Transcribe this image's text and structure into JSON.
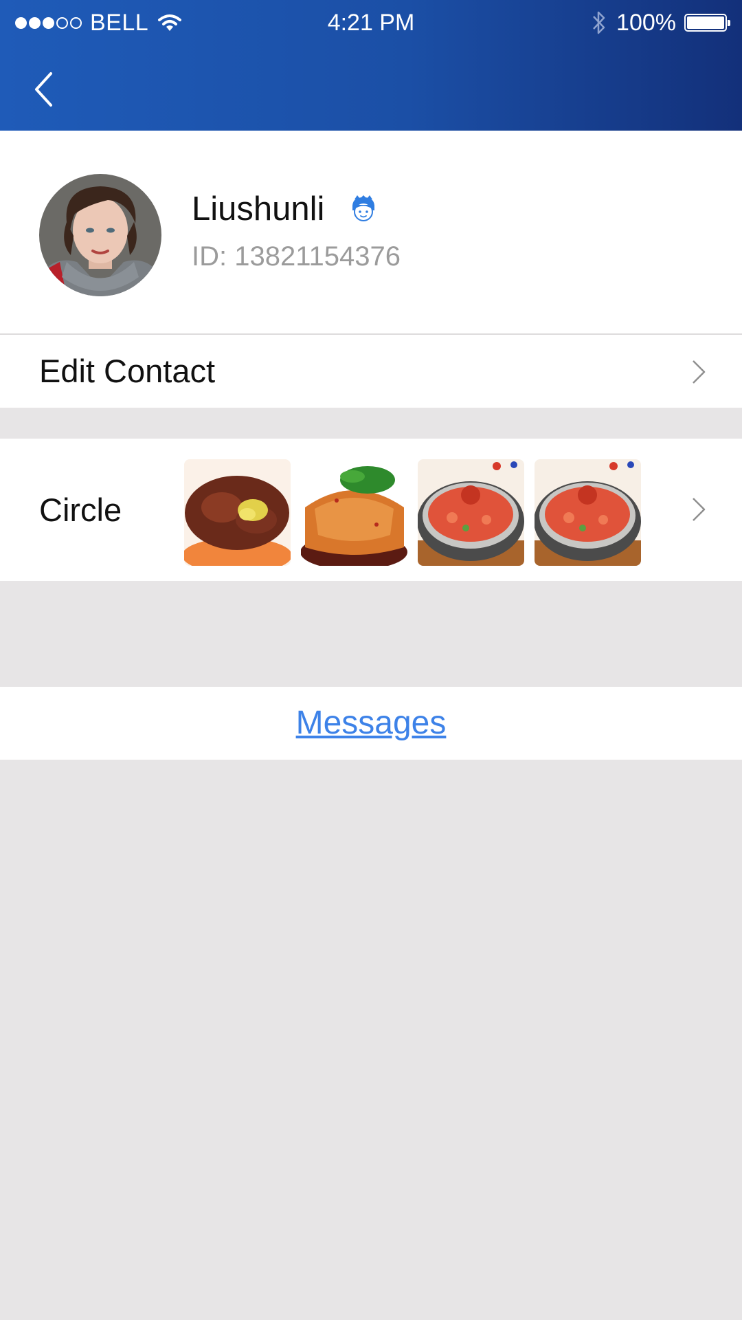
{
  "status_bar": {
    "signal_filled": 3,
    "signal_total": 5,
    "carrier": "BELL",
    "time": "4:21 PM",
    "battery_percent": "100%",
    "icons": [
      "wifi-icon",
      "bluetooth-icon",
      "battery-icon"
    ]
  },
  "nav": {
    "back_icon": "chevron-left-icon"
  },
  "profile": {
    "name": "Liushunli",
    "id_text": "ID: 13821154376",
    "badge_icon": "boy-face-icon",
    "badge_color": "#2f7de1"
  },
  "edit_contact": {
    "label": "Edit Contact"
  },
  "circle": {
    "label": "Circle",
    "thumbnails": [
      "braised-beef-dish",
      "chicken-in-chili-sauce-dish",
      "crayfish-rice-platter-dish",
      "crayfish-rice-platter-dish"
    ]
  },
  "messages": {
    "label": "Messages",
    "color": "#3d82e8"
  },
  "colors": {
    "header_gradient": [
      "#1f5bb8",
      "#13307a"
    ],
    "background": "#e7e5e6",
    "secondary_text": "#9b9b9b"
  }
}
